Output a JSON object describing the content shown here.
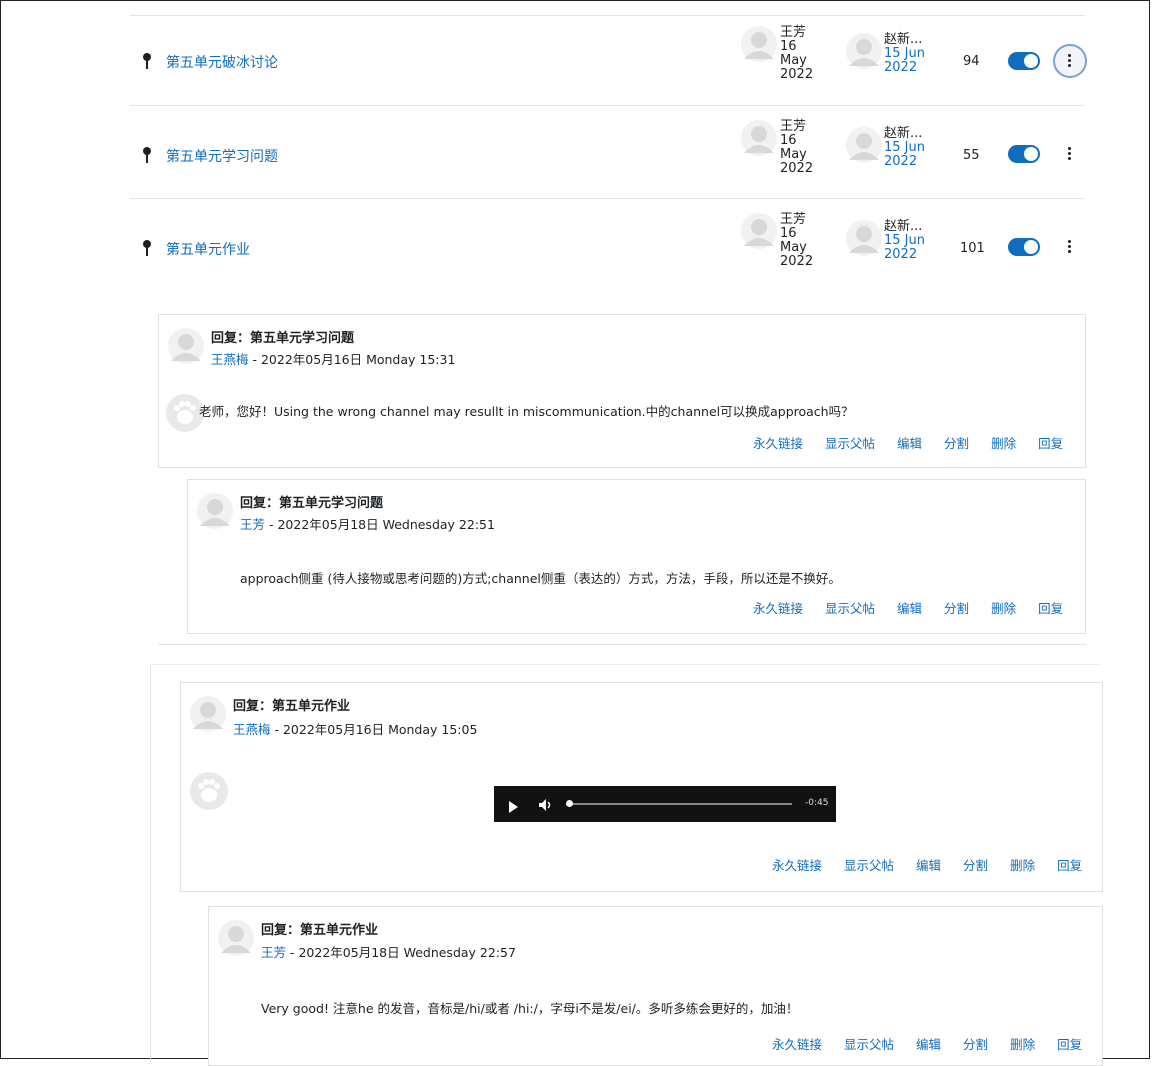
{
  "discussions": [
    {
      "title": "第五单元破冰讨论",
      "started_by": "王芳",
      "started_date": [
        "16",
        "May",
        "2022"
      ],
      "last_by": "赵新...",
      "last_date": [
        "15 Jun",
        "2022"
      ],
      "replies": "94",
      "subscribed": true
    },
    {
      "title": "第五单元学习问题",
      "started_by": "王芳",
      "started_date": [
        "16",
        "May",
        "2022"
      ],
      "last_by": "赵新...",
      "last_date": [
        "15 Jun",
        "2022"
      ],
      "replies": "55",
      "subscribed": true
    },
    {
      "title": "第五单元作业",
      "started_by": "王芳",
      "started_date": [
        "16",
        "May",
        "2022"
      ],
      "last_by": "赵新...",
      "last_date": [
        "15 Jun",
        "2022"
      ],
      "replies": "101",
      "subscribed": true
    }
  ],
  "actions": {
    "permalink": "永久链接",
    "show_parent": "显示父帖",
    "edit": "编辑",
    "split": "分割",
    "delete": "删除",
    "reply": "回复"
  },
  "posts": [
    {
      "title": "回复：第五单元学习问题",
      "author": "王燕梅",
      "date": " - 2022年05月16日 Monday 15:31",
      "body": "老师，您好！Using the wrong channel may resullt in miscommunication.中的channel可以换成approach吗？"
    },
    {
      "title": "回复：第五单元学习问题",
      "author": "王芳",
      "date": " - 2022年05月18日 Wednesday 22:51",
      "body": "approach侧重 (待人接物或思考问题的)方式;channel侧重（表达的）方式，方法，手段，所以还是不换好。"
    },
    {
      "title": "回复：第五单元作业",
      "author": "王燕梅",
      "date": " - 2022年05月16日 Monday 15:05",
      "audio_time": "-0:45"
    },
    {
      "title": "回复：第五单元作业",
      "author": "王芳",
      "date": " - 2022年05月18日 Wednesday 22:57",
      "body": "Very good! 注意he 的发音，音标是/hi/或者 /hi:/，字母i不是发/ei/。多听多练会更好的，加油！"
    }
  ],
  "colors": {
    "link": "#0f6cbf",
    "toggle_on": "#0f6cbf",
    "audio_bg": "#111111"
  }
}
